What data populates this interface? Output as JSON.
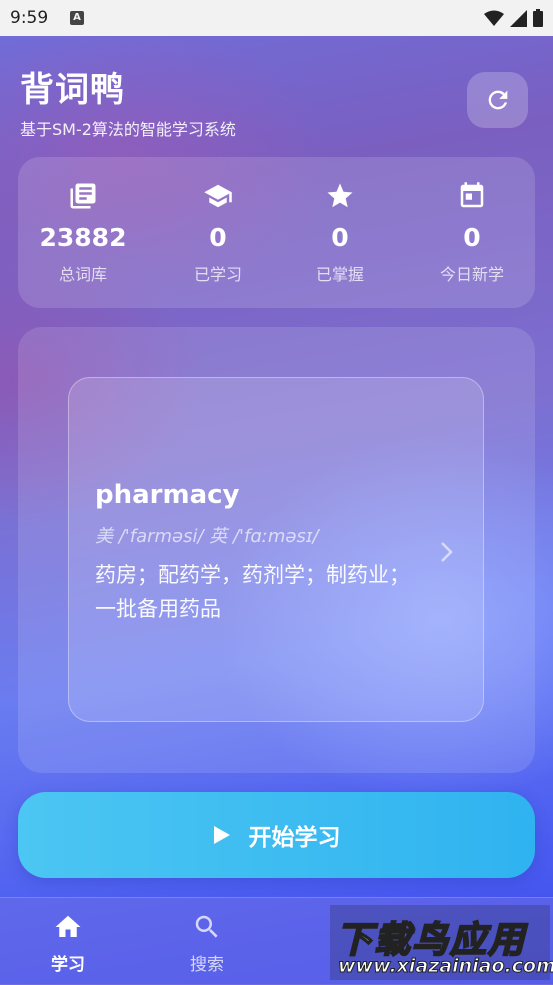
{
  "status_bar": {
    "time": "9:59",
    "notification_icon": "A"
  },
  "header": {
    "title": "背词鸭",
    "subtitle": "基于SM-2算法的智能学习系统",
    "refresh_icon": "refresh-icon"
  },
  "stats": [
    {
      "icon": "library-books-icon",
      "value": "23882",
      "label": "总词库"
    },
    {
      "icon": "school-icon",
      "value": "0",
      "label": "已学习"
    },
    {
      "icon": "star-icon",
      "value": "0",
      "label": "已掌握"
    },
    {
      "icon": "calendar-icon",
      "value": "0",
      "label": "今日新学"
    }
  ],
  "word_card": {
    "word": "pharmacy",
    "phonetic": "美 /'farməsi/  英 /'fɑːməsɪ/",
    "meaning": "药房；配药学，药剂学；制药业；一批备用药品"
  },
  "start_button": {
    "label": "开始学习"
  },
  "nav": {
    "items": [
      {
        "label": "学习",
        "active": true
      },
      {
        "label": "搜索",
        "active": false
      }
    ]
  },
  "watermark": {
    "text": "下载鸟应用",
    "url": "www.xiazainiao.com"
  },
  "colors": {
    "start_button": "#3bbaf0",
    "accent_bg": "#6a6fe0"
  }
}
